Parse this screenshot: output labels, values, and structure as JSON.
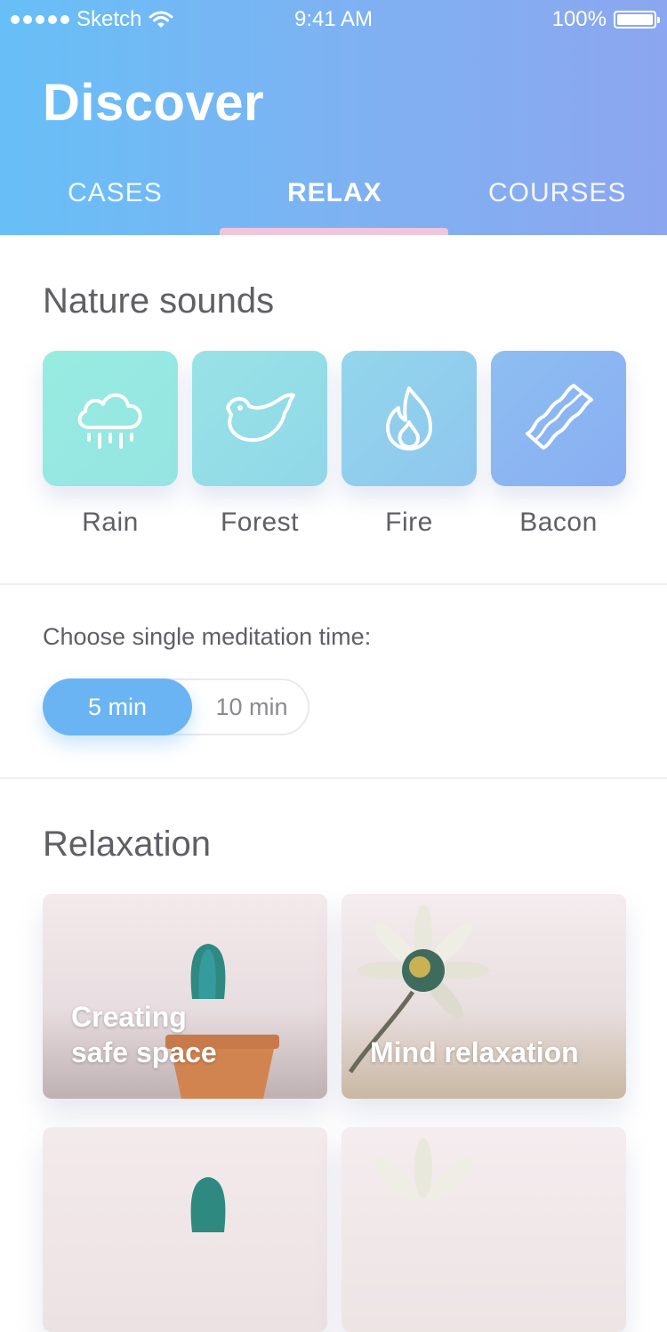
{
  "status_bar": {
    "carrier": "Sketch",
    "time": "9:41 AM",
    "battery": "100%"
  },
  "header": {
    "title": "Discover",
    "tabs": [
      {
        "label": "CASES",
        "active": false
      },
      {
        "label": "RELAX",
        "active": true
      },
      {
        "label": "COURSES",
        "active": false
      }
    ]
  },
  "nature_sounds": {
    "title": "Nature sounds",
    "items": [
      {
        "label": "Rain",
        "icon": "rain-cloud-icon"
      },
      {
        "label": "Forest",
        "icon": "bird-icon"
      },
      {
        "label": "Fire",
        "icon": "flame-icon"
      },
      {
        "label": "Bacon",
        "icon": "bacon-icon"
      }
    ]
  },
  "meditation_time": {
    "prompt": "Choose single meditation time:",
    "options": [
      "5 min",
      "10 min"
    ],
    "selected": "5 min"
  },
  "relaxation": {
    "title": "Relaxation",
    "cards": [
      {
        "label": "Creating\nsafe space",
        "image": "cactus-photo"
      },
      {
        "label": "Mind relaxation",
        "image": "daisy-photo"
      },
      {
        "label": "",
        "image": "cactus-photo"
      },
      {
        "label": "",
        "image": "daisy-photo"
      }
    ]
  },
  "colors": {
    "header_gradient_start": "#67bff7",
    "header_gradient_end": "#8ca6f0",
    "accent": "#6ab4f3",
    "tab_indicator": "#f0c6da"
  }
}
